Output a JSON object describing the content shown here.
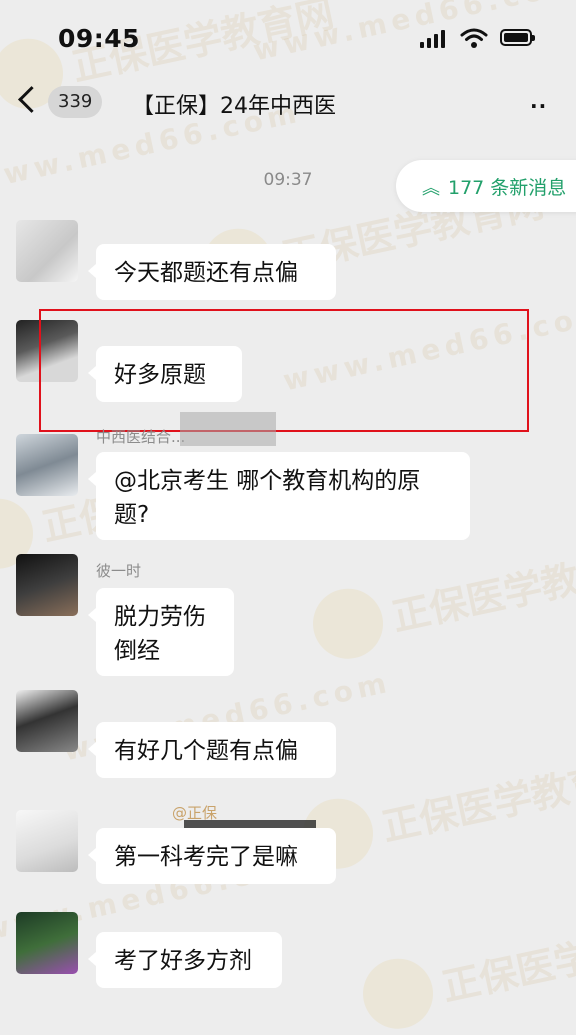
{
  "status_bar": {
    "time": "09:45"
  },
  "nav": {
    "unread_count": "339",
    "title": "【正保】24年中西医",
    "more_icon": "ellipsis-icon"
  },
  "chat": {
    "timestamp": "09:37",
    "new_messages_label": "177 条新消息",
    "messages": [
      {
        "sender": "",
        "text": "今天都题还有点偏"
      },
      {
        "sender": "",
        "text": "好多原题"
      },
      {
        "sender": "中西医结合...",
        "text": "@北京考生 哪个教育机构的原题?"
      },
      {
        "sender": "彼一时",
        "text": "脱力劳伤\n倒经"
      },
      {
        "sender": "",
        "text": "有好几个题有点偏"
      },
      {
        "sender": "@正保",
        "text": "第一科考完了是嘛"
      },
      {
        "sender": "",
        "text": "考了好多方剂"
      }
    ]
  },
  "watermark": {
    "brand": "正保医学教育网",
    "url": "www.med66.com"
  },
  "colors": {
    "accent": "#22a06b",
    "highlight": "#e0111b",
    "background": "#ededed"
  }
}
